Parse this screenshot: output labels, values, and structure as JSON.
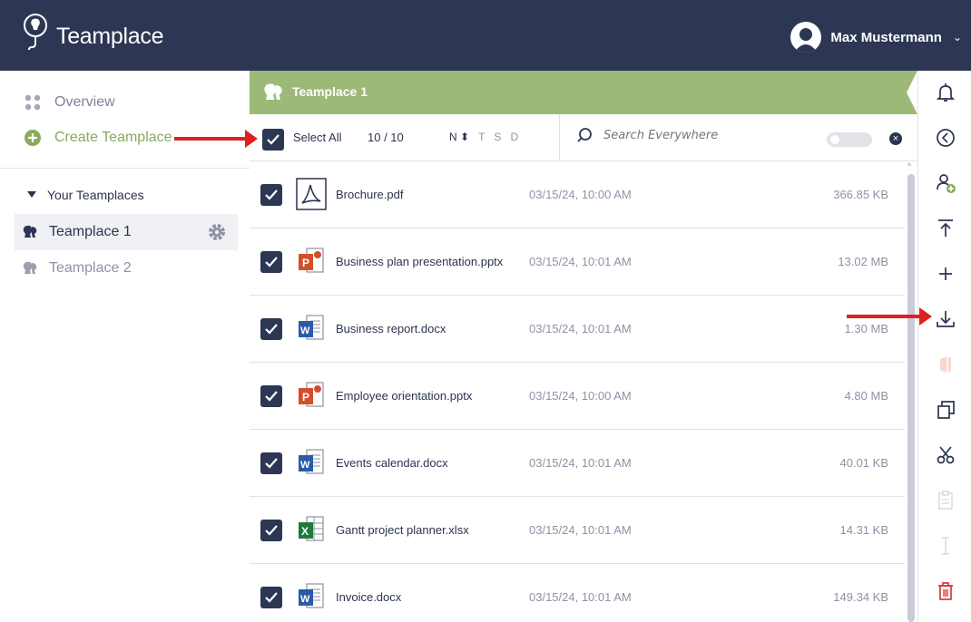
{
  "header": {
    "brand": "Teamplace",
    "user_name": "Max Mustermann"
  },
  "sidebar": {
    "overview_label": "Overview",
    "create_label": "Create Teamplace",
    "section_label": "Your Teamplaces",
    "teamplaces": [
      {
        "label": "Teamplace 1"
      },
      {
        "label": "Teamplace 2"
      }
    ]
  },
  "main": {
    "teamplace_title": "Teamplace 1",
    "toolbar": {
      "select_all_label": "Select All",
      "count": "10 / 10",
      "sort_options": [
        "N",
        "T",
        "S",
        "D"
      ],
      "search_placeholder": "Search Everywhere"
    },
    "files": [
      {
        "name": "Brochure.pdf",
        "date": "03/15/24, 10:00 AM",
        "size": "366.85 KB",
        "type": "pdf"
      },
      {
        "name": "Business plan presentation.pptx",
        "date": "03/15/24, 10:01 AM",
        "size": "13.02 MB",
        "type": "pptx"
      },
      {
        "name": "Business report.docx",
        "date": "03/15/24, 10:01 AM",
        "size": "1.30 MB",
        "type": "docx"
      },
      {
        "name": "Employee orientation.pptx",
        "date": "03/15/24, 10:00 AM",
        "size": "4.80 MB",
        "type": "pptx"
      },
      {
        "name": "Events calendar.docx",
        "date": "03/15/24, 10:01 AM",
        "size": "40.01 KB",
        "type": "docx"
      },
      {
        "name": "Gantt project planner.xlsx",
        "date": "03/15/24, 10:01 AM",
        "size": "14.31 KB",
        "type": "xlsx"
      },
      {
        "name": "Invoice.docx",
        "date": "03/15/24, 10:01 AM",
        "size": "149.34 KB",
        "type": "docx"
      }
    ]
  },
  "rail": {
    "icons": [
      "bell-icon",
      "back-icon",
      "add-member-icon",
      "upload-icon",
      "plus-icon",
      "download-icon",
      "office-icon",
      "copy-icon",
      "cut-icon",
      "paste-icon",
      "rename-icon",
      "delete-icon"
    ]
  },
  "colors": {
    "header_bg": "#2d3754",
    "accent_green": "#9db977",
    "create_green": "#87ab5b",
    "annotation_red": "#e02020",
    "delete_red": "#d63a3a"
  }
}
